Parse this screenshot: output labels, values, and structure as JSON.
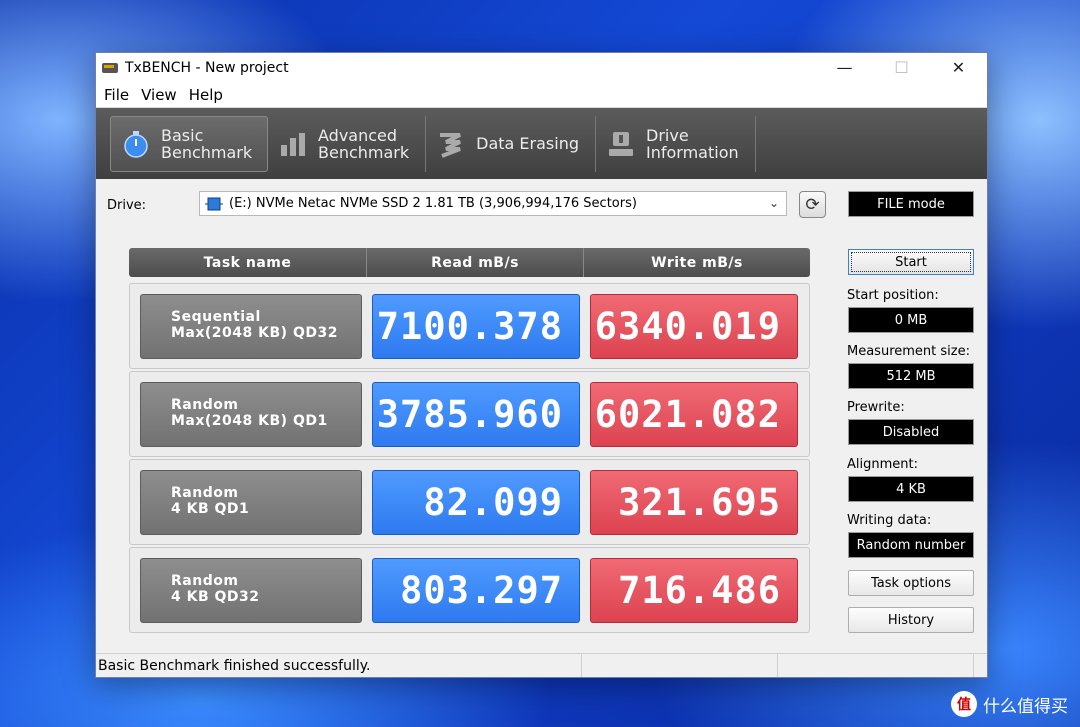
{
  "window": {
    "title": "TxBENCH - New project"
  },
  "menu": {
    "file": "File",
    "view": "View",
    "help": "Help"
  },
  "tabs": [
    {
      "line1": "Basic",
      "line2": "Benchmark"
    },
    {
      "line1": "Advanced",
      "line2": "Benchmark"
    },
    {
      "line1": "Data Erasing",
      "line2": ""
    },
    {
      "line1": "Drive",
      "line2": "Information"
    }
  ],
  "drive": {
    "label": "Drive:",
    "selected": "(E:) NVMe Netac NVMe SSD 2  1.81 TB (3,906,994,176 Sectors)",
    "mode": "FILE mode"
  },
  "table": {
    "headers": [
      "Task name",
      "Read mB/s",
      "Write mB/s"
    ],
    "rows": [
      {
        "name1": "Sequential",
        "name2": "Max(2048 KB) QD32",
        "read": "7100.378",
        "write": "6340.019"
      },
      {
        "name1": "Random",
        "name2": "Max(2048 KB) QD1",
        "read": "3785.960",
        "write": "6021.082"
      },
      {
        "name1": "Random",
        "name2": "4 KB QD1",
        "read": "82.099",
        "write": "321.695"
      },
      {
        "name1": "Random",
        "name2": "4 KB QD32",
        "read": "803.297",
        "write": "716.486"
      }
    ]
  },
  "panel": {
    "start": "Start",
    "start_position_label": "Start position:",
    "start_position": "0 MB",
    "measurement_size_label": "Measurement size:",
    "measurement_size": "512 MB",
    "prewrite_label": "Prewrite:",
    "prewrite": "Disabled",
    "alignment_label": "Alignment:",
    "alignment": "4 KB",
    "writing_data_label": "Writing data:",
    "writing_data": "Random number",
    "task_options": "Task options",
    "history": "History"
  },
  "status": {
    "text": "Basic Benchmark finished successfully."
  },
  "watermark": {
    "text": "什么值得买",
    "logo": "值"
  },
  "colors": {
    "read": "#3a86f5",
    "write": "#e5525e",
    "toolbar": "#4a4a4a"
  }
}
